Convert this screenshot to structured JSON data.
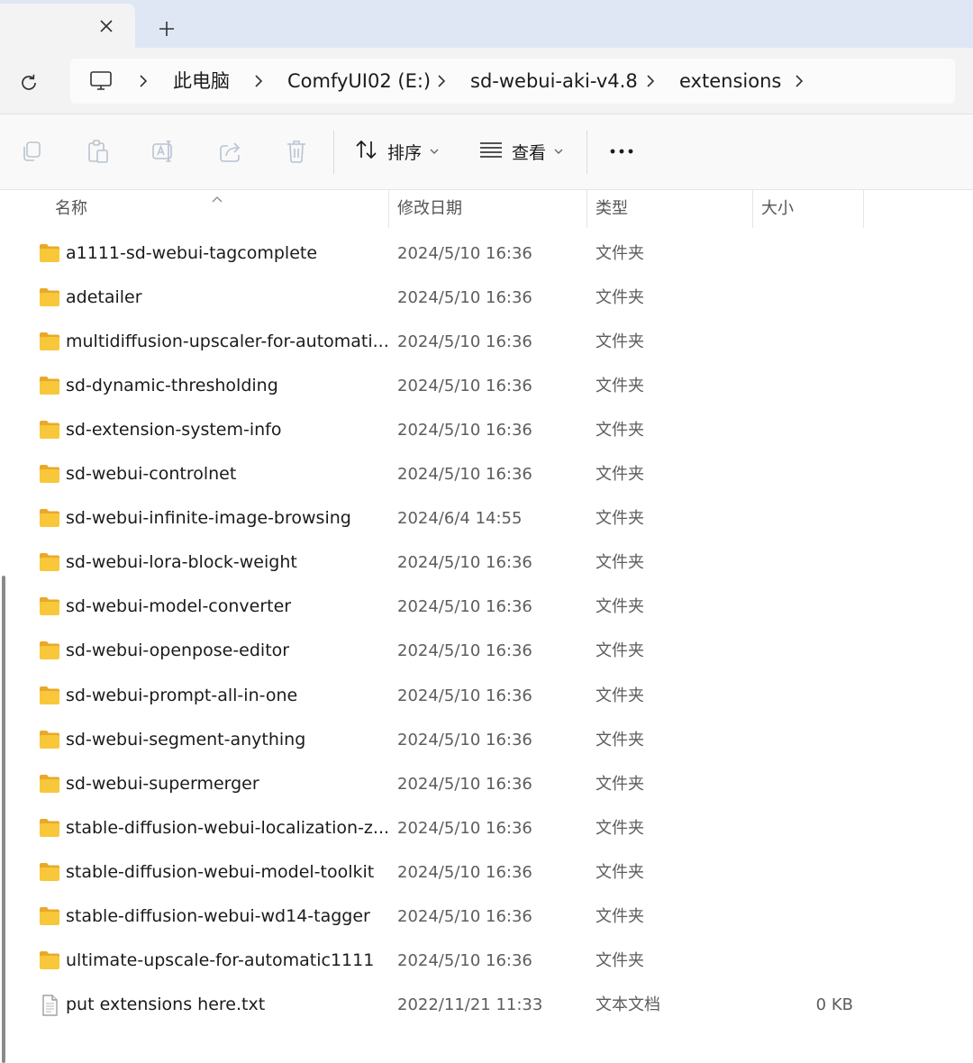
{
  "tabs": {
    "close_icon": "close-icon",
    "new_tab_icon": "plus-icon"
  },
  "address": {
    "refresh_icon": "refresh-icon",
    "root_icon": "computer-icon",
    "breadcrumbs": [
      "此电脑",
      "ComfyUI02 (E:)",
      "sd-webui-aki-v4.8",
      "extensions"
    ]
  },
  "toolbar": {
    "icons": [
      "copy-icon",
      "paste-icon",
      "rename-icon",
      "share-icon",
      "delete-icon"
    ],
    "sort_label": "排序",
    "view_label": "查看",
    "more_icon": "more-icon"
  },
  "columns": {
    "name": "名称",
    "modified": "修改日期",
    "type": "类型",
    "size": "大小"
  },
  "files": [
    {
      "name": "a1111-sd-webui-tagcomplete",
      "modified": "2024/5/10 16:36",
      "type": "文件夹",
      "size": "",
      "kind": "folder"
    },
    {
      "name": "adetailer",
      "modified": "2024/5/10 16:36",
      "type": "文件夹",
      "size": "",
      "kind": "folder"
    },
    {
      "name": "multidiffusion-upscaler-for-automati...",
      "modified": "2024/5/10 16:36",
      "type": "文件夹",
      "size": "",
      "kind": "folder"
    },
    {
      "name": "sd-dynamic-thresholding",
      "modified": "2024/5/10 16:36",
      "type": "文件夹",
      "size": "",
      "kind": "folder"
    },
    {
      "name": "sd-extension-system-info",
      "modified": "2024/5/10 16:36",
      "type": "文件夹",
      "size": "",
      "kind": "folder"
    },
    {
      "name": "sd-webui-controlnet",
      "modified": "2024/5/10 16:36",
      "type": "文件夹",
      "size": "",
      "kind": "folder"
    },
    {
      "name": "sd-webui-infinite-image-browsing",
      "modified": "2024/6/4 14:55",
      "type": "文件夹",
      "size": "",
      "kind": "folder"
    },
    {
      "name": "sd-webui-lora-block-weight",
      "modified": "2024/5/10 16:36",
      "type": "文件夹",
      "size": "",
      "kind": "folder"
    },
    {
      "name": "sd-webui-model-converter",
      "modified": "2024/5/10 16:36",
      "type": "文件夹",
      "size": "",
      "kind": "folder"
    },
    {
      "name": "sd-webui-openpose-editor",
      "modified": "2024/5/10 16:36",
      "type": "文件夹",
      "size": "",
      "kind": "folder"
    },
    {
      "name": "sd-webui-prompt-all-in-one",
      "modified": "2024/5/10 16:36",
      "type": "文件夹",
      "size": "",
      "kind": "folder"
    },
    {
      "name": "sd-webui-segment-anything",
      "modified": "2024/5/10 16:36",
      "type": "文件夹",
      "size": "",
      "kind": "folder"
    },
    {
      "name": "sd-webui-supermerger",
      "modified": "2024/5/10 16:36",
      "type": "文件夹",
      "size": "",
      "kind": "folder"
    },
    {
      "name": "stable-diffusion-webui-localization-z...",
      "modified": "2024/5/10 16:36",
      "type": "文件夹",
      "size": "",
      "kind": "folder"
    },
    {
      "name": "stable-diffusion-webui-model-toolkit",
      "modified": "2024/5/10 16:36",
      "type": "文件夹",
      "size": "",
      "kind": "folder"
    },
    {
      "name": "stable-diffusion-webui-wd14-tagger",
      "modified": "2024/5/10 16:36",
      "type": "文件夹",
      "size": "",
      "kind": "folder"
    },
    {
      "name": "ultimate-upscale-for-automatic1111",
      "modified": "2024/5/10 16:36",
      "type": "文件夹",
      "size": "",
      "kind": "folder"
    },
    {
      "name": "put extensions here.txt",
      "modified": "2022/11/21 11:33",
      "type": "文本文档",
      "size": "0 KB",
      "kind": "text"
    }
  ],
  "colors": {
    "folder": "#f8c73a",
    "folder_back": "#e8a92a",
    "accent": "#0067c0"
  }
}
